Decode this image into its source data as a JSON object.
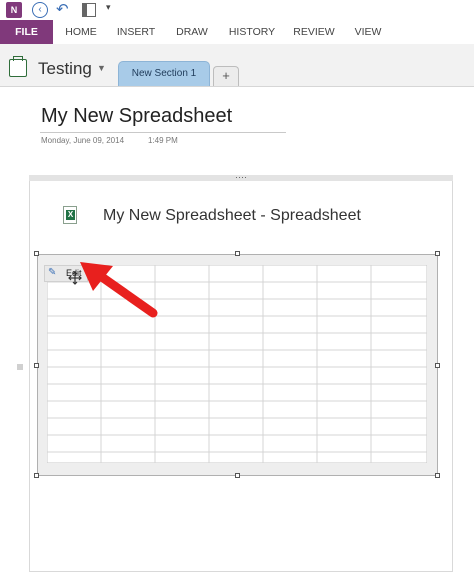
{
  "app": {
    "logo_label": "N"
  },
  "qat": {
    "more_glyph": "▾"
  },
  "ribbon": {
    "tabs": [
      "FILE",
      "HOME",
      "INSERT",
      "DRAW",
      "HISTORY",
      "REVIEW",
      "VIEW"
    ]
  },
  "notebook": {
    "name": "Testing",
    "sections": [
      "New Section 1"
    ],
    "add_section": "+"
  },
  "page": {
    "title": "My New Spreadsheet",
    "date": "Monday, June 09, 2014",
    "time": "1:49 PM",
    "embed_title": "My New Spreadsheet - Spreadsheet",
    "edit_label": "Edit"
  },
  "colors": {
    "file_tab": "#80397b",
    "section_tab": "#a8cbe8",
    "excel_green": "#207245",
    "arrow_red": "#e8201e"
  }
}
